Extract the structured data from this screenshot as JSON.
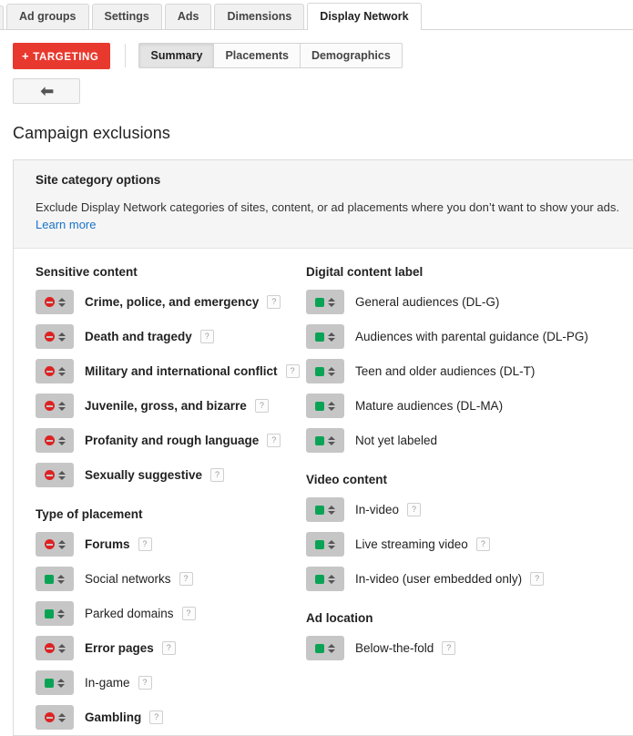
{
  "tabs": [
    {
      "label": "Ad groups",
      "active": false
    },
    {
      "label": "Settings",
      "active": false
    },
    {
      "label": "Ads",
      "active": false
    },
    {
      "label": "Dimensions",
      "active": false
    },
    {
      "label": "Display Network",
      "active": true
    }
  ],
  "toolbar": {
    "targeting_label": "TARGETING",
    "targeting_plus": "+",
    "targeting_color": "#e8392e",
    "back_icon": "back-arrow-icon",
    "subtabs": [
      {
        "label": "Summary",
        "active": true
      },
      {
        "label": "Placements",
        "active": false
      },
      {
        "label": "Demographics",
        "active": false
      }
    ]
  },
  "page_title": "Campaign exclusions",
  "card": {
    "heading": "Site category options",
    "description": "Exclude Display Network categories of sites, content, or ad placements where you don’t want to show your ads.",
    "learn_more": "Learn more",
    "link_color": "#1a73c8"
  },
  "help_glyph": "?",
  "status": {
    "excluded_color": "#dd2222",
    "included_color": "#0aa355"
  },
  "left_groups": [
    {
      "title": "Sensitive content",
      "items": [
        {
          "label": "Crime, police, and emergency",
          "state": "excluded",
          "help": true
        },
        {
          "label": "Death and tragedy",
          "state": "excluded",
          "help": true
        },
        {
          "label": "Military and international conflict",
          "state": "excluded",
          "help": true
        },
        {
          "label": "Juvenile, gross, and bizarre",
          "state": "excluded",
          "help": true
        },
        {
          "label": "Profanity and rough language",
          "state": "excluded",
          "help": true
        },
        {
          "label": "Sexually suggestive",
          "state": "excluded",
          "help": true
        }
      ]
    },
    {
      "title": "Type of placement",
      "items": [
        {
          "label": "Forums",
          "state": "excluded",
          "help": true
        },
        {
          "label": "Social networks",
          "state": "included",
          "help": true
        },
        {
          "label": "Parked domains",
          "state": "included",
          "help": true
        },
        {
          "label": "Error pages",
          "state": "excluded",
          "help": true
        },
        {
          "label": "In-game",
          "state": "included",
          "help": true
        },
        {
          "label": "Gambling",
          "state": "excluded",
          "help": true
        }
      ]
    }
  ],
  "right_groups": [
    {
      "title": "Digital content label",
      "items": [
        {
          "label": "General audiences (DL-G)",
          "state": "included",
          "help": false
        },
        {
          "label": "Audiences with parental guidance (DL-PG)",
          "state": "included",
          "help": false
        },
        {
          "label": "Teen and older audiences (DL-T)",
          "state": "included",
          "help": false
        },
        {
          "label": "Mature audiences (DL-MA)",
          "state": "included",
          "help": false
        },
        {
          "label": "Not yet labeled",
          "state": "included",
          "help": false
        }
      ]
    },
    {
      "title": "Video content",
      "items": [
        {
          "label": "In-video",
          "state": "included",
          "help": true
        },
        {
          "label": "Live streaming video",
          "state": "included",
          "help": true
        },
        {
          "label": "In-video (user embedded only)",
          "state": "included",
          "help": true
        }
      ]
    },
    {
      "title": "Ad location",
      "items": [
        {
          "label": "Below-the-fold",
          "state": "included",
          "help": true
        }
      ]
    }
  ]
}
